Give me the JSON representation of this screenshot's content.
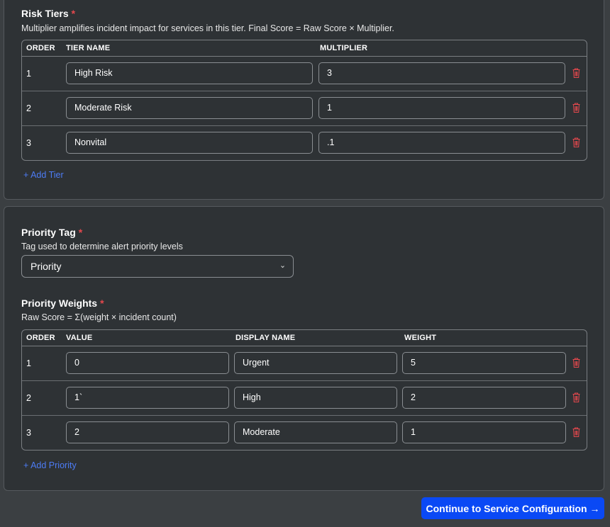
{
  "risk_tiers": {
    "title": "Risk Tiers",
    "required_mark": "*",
    "description": "Multiplier amplifies incident impact for services in this tier. Final Score = Raw Score × Multiplier.",
    "columns": {
      "order": "ORDER",
      "tier_name": "TIER NAME",
      "multiplier": "MULTIPLIER"
    },
    "rows": [
      {
        "order": "1",
        "tier_name": "High Risk",
        "multiplier": "3"
      },
      {
        "order": "2",
        "tier_name": "Moderate Risk",
        "multiplier": "1"
      },
      {
        "order": "3",
        "tier_name": "Nonvital",
        "multiplier": ".1"
      }
    ],
    "add_label": "+ Add Tier"
  },
  "priority_tag": {
    "title": "Priority Tag",
    "required_mark": "*",
    "description": "Tag used to determine alert priority levels",
    "selected": "Priority"
  },
  "priority_weights": {
    "title": "Priority Weights",
    "required_mark": "*",
    "description": "Raw Score = Σ(weight × incident count)",
    "columns": {
      "order": "ORDER",
      "value": "VALUE",
      "display_name": "DISPLAY NAME",
      "weight": "WEIGHT"
    },
    "rows": [
      {
        "order": "1",
        "value": "0",
        "display_name": "Urgent",
        "weight": "5"
      },
      {
        "order": "2",
        "value": "1`",
        "display_name": "High",
        "weight": "2"
      },
      {
        "order": "3",
        "value": "2",
        "display_name": "Moderate",
        "weight": "1"
      }
    ],
    "add_label": "+ Add Priority"
  },
  "footer": {
    "continue_label": "Continue to Service Configuration →"
  },
  "colors": {
    "accent": "#0a49f5",
    "link": "#4d7cf5",
    "danger": "#e5484d",
    "card_bg": "#2e3235",
    "page_bg": "#3b3f42"
  },
  "icons": {
    "delete": "trash-icon",
    "dropdown": "chevron-down-icon"
  }
}
